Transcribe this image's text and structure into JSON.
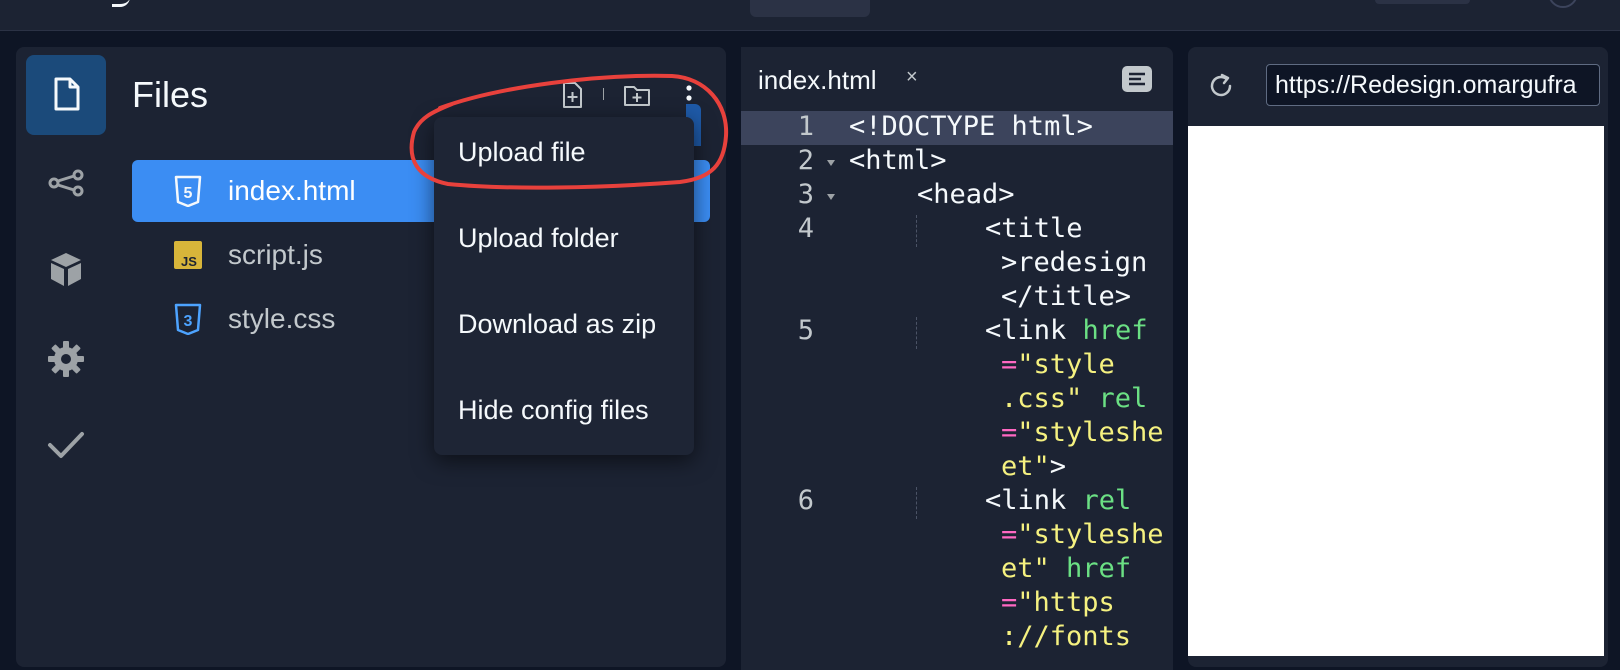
{
  "files_panel": {
    "title": "Files",
    "files": [
      {
        "name": "index.html",
        "type": "html",
        "selected": true
      },
      {
        "name": "script.js",
        "type": "js",
        "selected": false
      },
      {
        "name": "style.css",
        "type": "css",
        "selected": false
      }
    ]
  },
  "dropdown_menu": {
    "items": [
      "Upload file",
      "Upload folder",
      "Download as zip",
      "Hide config files"
    ]
  },
  "icons": {
    "rail": [
      "files-icon",
      "git-branch-icon",
      "packages-icon",
      "settings-icon",
      "checkmark-icon"
    ],
    "header": [
      "new-file-icon",
      "new-folder-icon",
      "more-vertical-icon"
    ],
    "html_badge": "5",
    "js_badge": "JS",
    "css_badge": "3"
  },
  "editor": {
    "tab_label": "index.html",
    "close_glyph": "×",
    "line_numbers": [
      "1",
      "2",
      "3",
      "4",
      "5",
      "6"
    ],
    "lines": {
      "l1": "<!DOCTYPE html>",
      "l2": "<html>",
      "l3": "<head>",
      "l4a": "<title",
      "l4b": ">redesign",
      "l4c": "</title>",
      "l5a_tag": "<link ",
      "l5a_attr": "href",
      "l5b_op": "=",
      "l5b_str": "\"style",
      "l5c_str": ".css\"",
      "l5c_attr": "rel",
      "l5d_op": "=",
      "l5d_str": "\"styleshe",
      "l5e_str": "et\"",
      "l5e_tag": ">",
      "l6a_tag": "<link ",
      "l6a_attr": "rel",
      "l6b_op": "=",
      "l6b_str": "\"styleshe",
      "l6c_str": "et\"",
      "l6c_attr": "href",
      "l6d_op": "=",
      "l6d_str": "\"https",
      "l6e_str": "://fonts"
    }
  },
  "preview": {
    "url": "https://Redesign.omargufra"
  },
  "colors": {
    "background": "#0e1525",
    "panel": "#1c2333",
    "selected_file": "#3b8df3",
    "rail_active": "#1b4a7a",
    "annotation": "#e8413c",
    "html_icon": "#f5f9fc",
    "js_icon": "#d7b53a",
    "css_icon": "#4da3ff"
  }
}
